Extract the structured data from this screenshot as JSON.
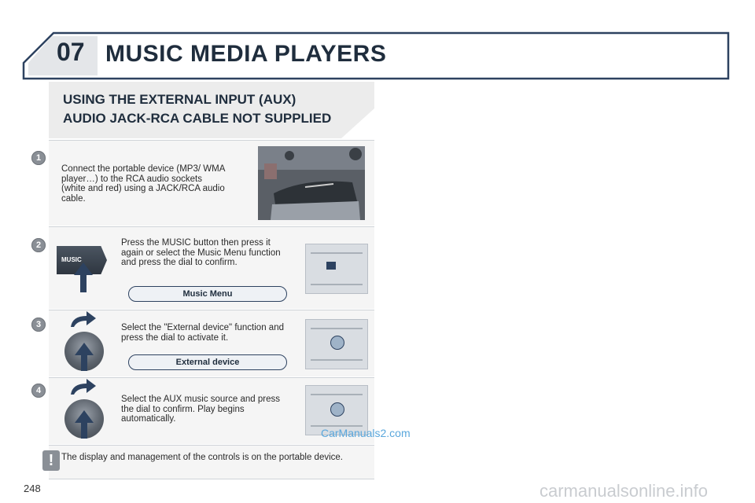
{
  "header": {
    "chapter": "07",
    "title": "MUSIC MEDIA PLAYERS"
  },
  "section": {
    "heading_line1": "USING THE EXTERNAL INPUT (AUX)",
    "heading_line2": "AUDIO JACK-RCA CABLE NOT SUPPLIED"
  },
  "steps": [
    {
      "number": "1",
      "text": "Connect the portable device (MP3/ WMA player…) to the RCA audio sockets (white and red) using a JACK/RCA audio cable."
    },
    {
      "number": "2",
      "text": "Press the MUSIC button then press it again or select the Music Menu function and press the dial to confirm.",
      "button_label": "MUSIC",
      "pill": "Music Menu"
    },
    {
      "number": "3",
      "text": "Select the \"External device\" function and press the dial to activate it.",
      "pill": "External device"
    },
    {
      "number": "4",
      "text": "Select the AUX music source and press the dial to confirm. Play begins automatically."
    }
  ],
  "note": {
    "symbol": "!",
    "text": "The display and management of the controls is on the portable device."
  },
  "page_number": "248",
  "watermark": "CarManuals2.com",
  "footer_watermark": "carmanualsonline.info"
}
